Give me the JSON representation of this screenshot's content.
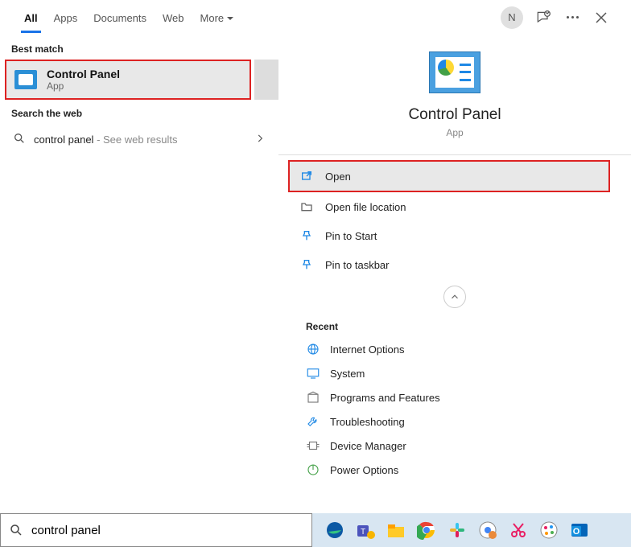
{
  "tabs": {
    "all": "All",
    "apps": "Apps",
    "documents": "Documents",
    "web": "Web",
    "more": "More"
  },
  "top": {
    "avatar_letter": "N"
  },
  "left": {
    "best_match_heading": "Best match",
    "best_match": {
      "title": "Control Panel",
      "sub": "App"
    },
    "search_web_heading": "Search the web",
    "web_item": {
      "query": "control panel",
      "hint": " - See web results"
    }
  },
  "preview": {
    "title": "Control Panel",
    "sub": "App"
  },
  "actions": {
    "open": "Open",
    "open_file_location": "Open file location",
    "pin_start": "Pin to Start",
    "pin_taskbar": "Pin to taskbar"
  },
  "recent": {
    "heading": "Recent",
    "items": [
      "Internet Options",
      "System",
      "Programs and Features",
      "Troubleshooting",
      "Device Manager",
      "Power Options"
    ]
  },
  "search": {
    "value": "control panel"
  }
}
